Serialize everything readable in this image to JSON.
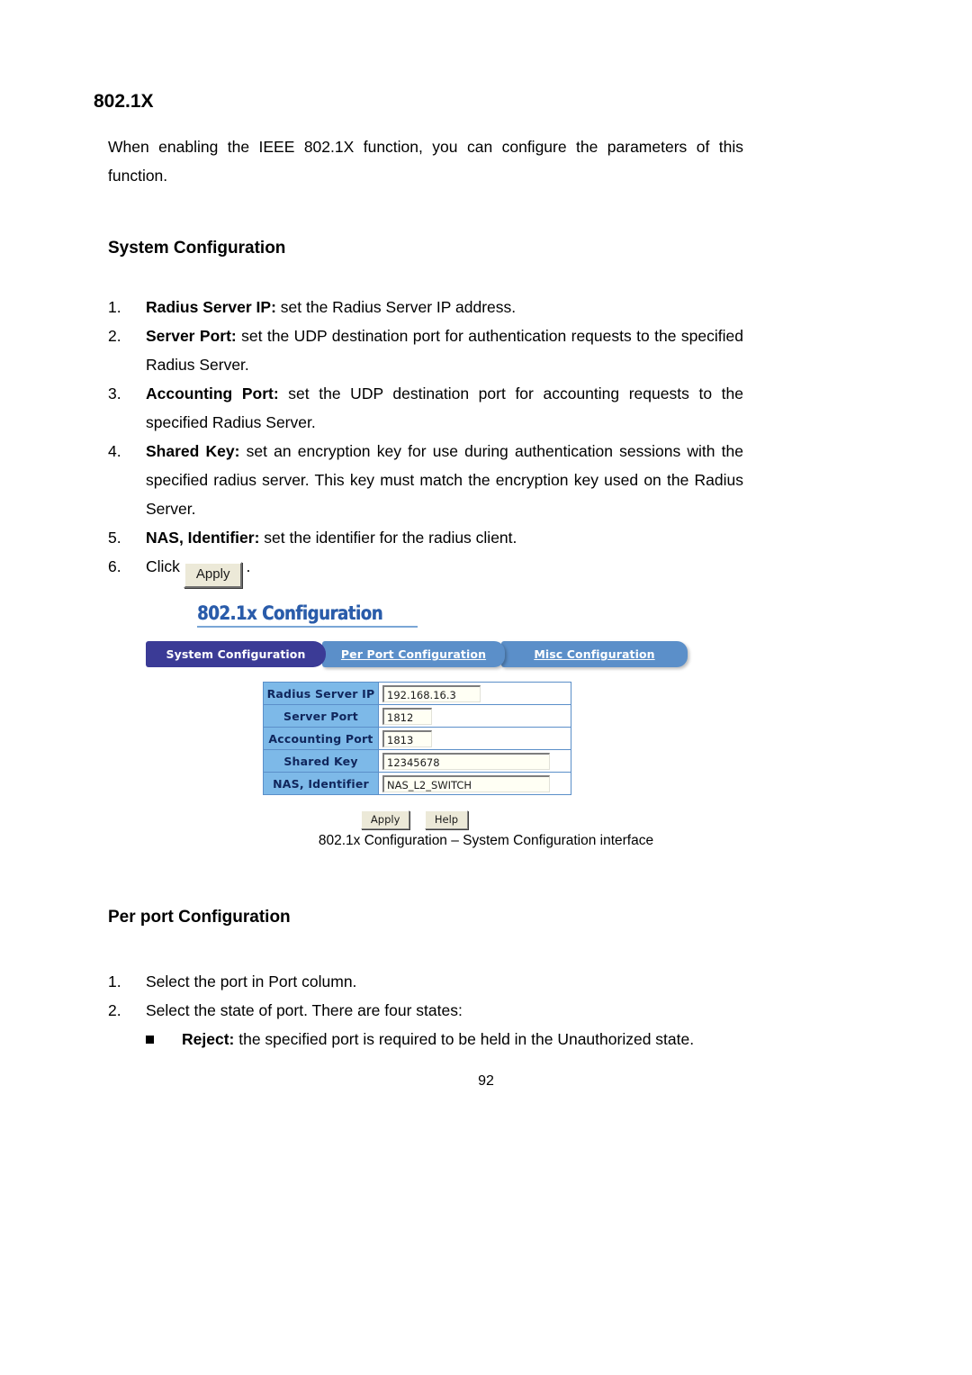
{
  "document": {
    "section_title": "802.1X",
    "intro_paragraph": "When enabling the IEEE 802.1X function, you can configure the parameters of this function.",
    "system_config_heading": "System Configuration",
    "system_config_steps": [
      {
        "num": "1.",
        "term": "Radius Server IP:",
        "text": " set the Radius Server IP address."
      },
      {
        "num": "2.",
        "term": "Server Port:",
        "text": " set the UDP destination port for authentication requests to the specified Radius Server."
      },
      {
        "num": "3.",
        "term": "Accounting Port:",
        "text": " set the UDP destination port for accounting requests to the specified Radius Server."
      },
      {
        "num": "4.",
        "term": "Shared Key:",
        "text": " set an encryption key for use during authentication sessions with the specified radius server. This key must match the encryption key used on the Radius Server."
      },
      {
        "num": "5.",
        "term": "NAS, Identifier:",
        "text": " set the identifier for the radius client."
      }
    ],
    "step6": {
      "num": "6.",
      "prefix": "Click",
      "button_label": "Apply",
      "suffix": "."
    },
    "figure_caption": "802.1x Configuration – System Configuration interface",
    "per_port_heading": "Per port Configuration",
    "per_port_steps": [
      {
        "num": "1.",
        "text": "Select the port in Port column."
      },
      {
        "num": "2.",
        "text": "Select the state of port. There are four states:"
      }
    ],
    "state_bullets": [
      {
        "term": "Reject:",
        "text": " the specified port is required to be held in the Unauthorized state."
      }
    ],
    "page_number": "92"
  },
  "screenshot": {
    "title": "802.1x Configuration",
    "tabs": [
      {
        "label": "System Configuration",
        "active": true
      },
      {
        "label": "Per Port Configuration",
        "active": false
      },
      {
        "label": "Misc Configuration",
        "active": false
      }
    ],
    "fields": [
      {
        "label": "Radius Server IP",
        "value": "192.168.16.3",
        "size": "ip"
      },
      {
        "label": "Server Port",
        "value": "1812",
        "size": "port"
      },
      {
        "label": "Accounting Port",
        "value": "1813",
        "size": "port"
      },
      {
        "label": "Shared Key",
        "value": "12345678",
        "size": "long"
      },
      {
        "label": "NAS, Identifier",
        "value": "NAS_L2_SWITCH",
        "size": "long"
      }
    ],
    "buttons": [
      {
        "label": "Apply"
      },
      {
        "label": "Help"
      }
    ],
    "colors": {
      "title_blue": "#2a5caa",
      "active_tab": "#3b3b96",
      "inactive_tab": "#5b8fc9",
      "label_cell": "#7db9e8",
      "label_text": "#10265c",
      "button_face": "#ece9d8"
    }
  }
}
